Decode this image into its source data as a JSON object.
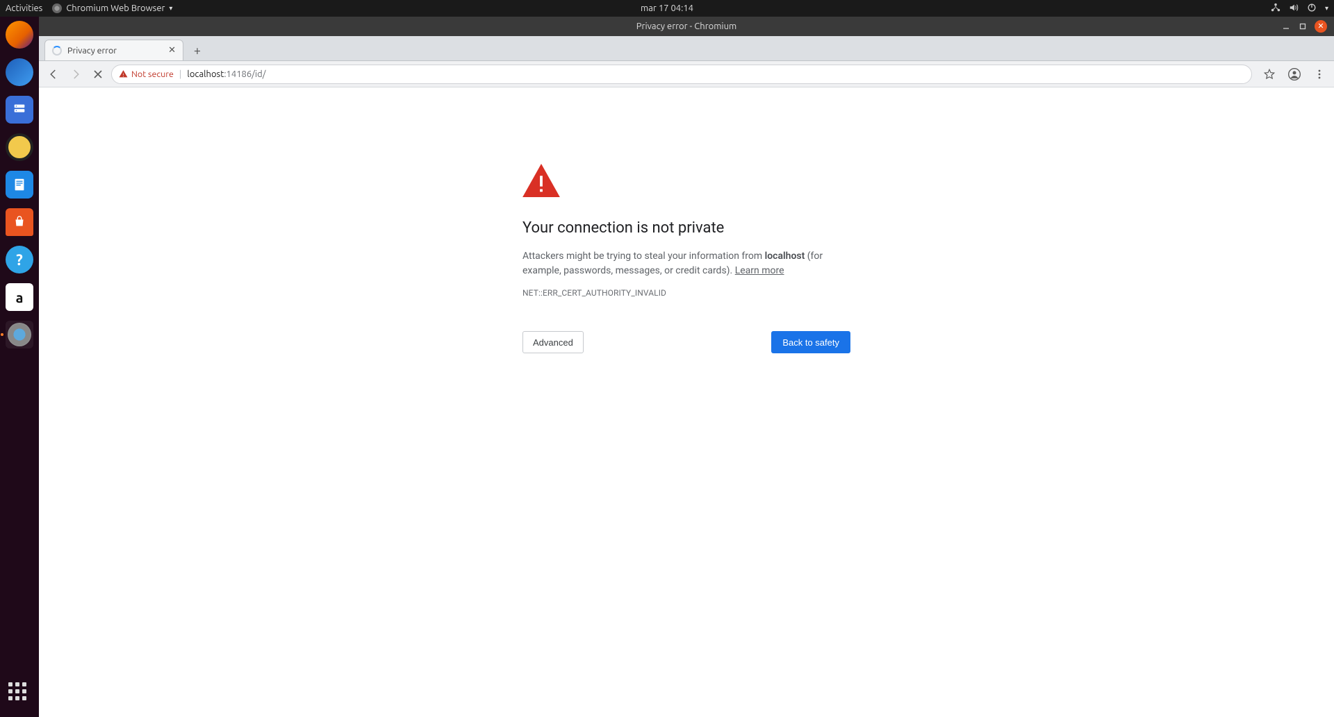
{
  "gnome": {
    "activities": "Activities",
    "app_menu": "Chromium Web Browser",
    "clock": "mar 17  04:14"
  },
  "dock": {
    "apps": [
      "firefox",
      "thunderbird",
      "files",
      "rhythmbox",
      "writer",
      "software",
      "help",
      "amazon",
      "chromium"
    ]
  },
  "window": {
    "title": "Privacy error - Chromium"
  },
  "tab": {
    "title": "Privacy error"
  },
  "toolbar": {
    "security_label": "Not secure",
    "url_host": "localhost",
    "url_rest": ":14186/id/"
  },
  "page": {
    "heading": "Your connection is not private",
    "body_pre": "Attackers might be trying to steal your information from ",
    "body_host": "localhost",
    "body_post": " (for example, passwords, messages, or credit cards). ",
    "learn_more": "Learn more",
    "error_code": "NET::ERR_CERT_AUTHORITY_INVALID",
    "advanced": "Advanced",
    "back": "Back to safety"
  }
}
